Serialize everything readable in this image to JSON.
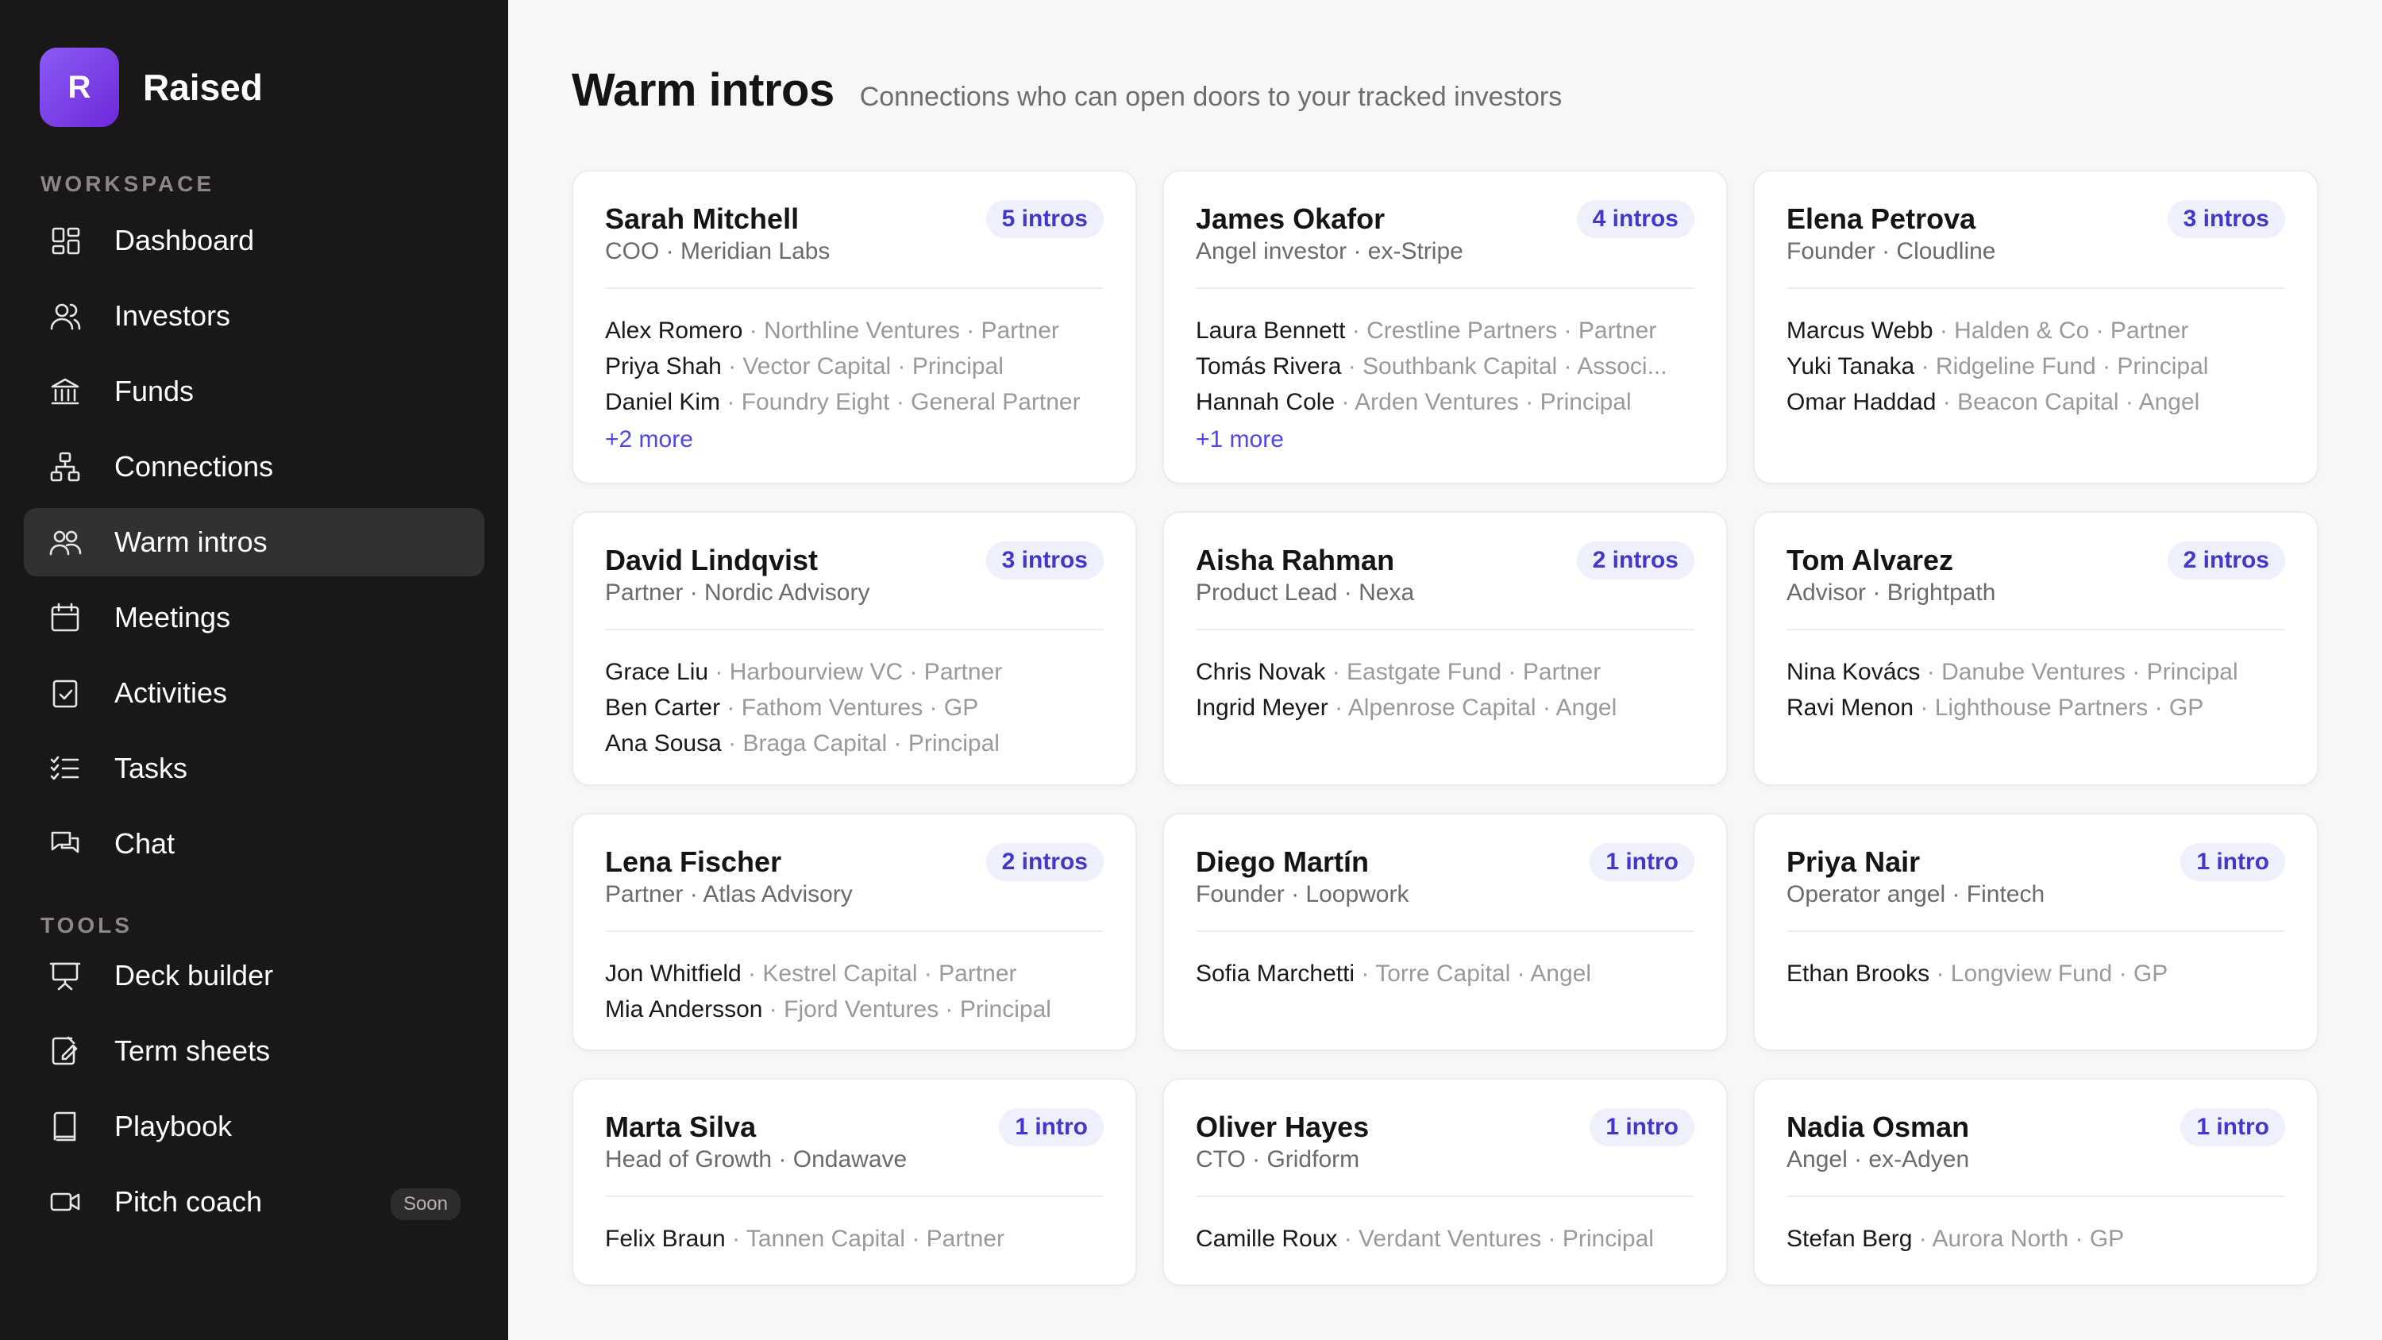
{
  "brand": {
    "logo_letter": "R",
    "name": "Raised"
  },
  "sidebar": {
    "workspace_label": "WORKSPACE",
    "tools_label": "TOOLS",
    "workspace_items": [
      {
        "label": "Dashboard",
        "icon": "grid-icon",
        "active": false
      },
      {
        "label": "Investors",
        "icon": "users-icon",
        "active": false
      },
      {
        "label": "Funds",
        "icon": "bank-icon",
        "active": false
      },
      {
        "label": "Connections",
        "icon": "network-icon",
        "active": false
      },
      {
        "label": "Warm intros",
        "icon": "user-group-icon",
        "active": true
      },
      {
        "label": "Meetings",
        "icon": "calendar-icon",
        "active": false
      },
      {
        "label": "Activities",
        "icon": "clipboard-check-icon",
        "active": false
      },
      {
        "label": "Tasks",
        "icon": "checklist-icon",
        "active": false
      },
      {
        "label": "Chat",
        "icon": "chat-icon",
        "active": false
      }
    ],
    "tool_items": [
      {
        "label": "Deck builder",
        "icon": "presentation-icon",
        "badge": ""
      },
      {
        "label": "Term sheets",
        "icon": "document-edit-icon",
        "badge": ""
      },
      {
        "label": "Playbook",
        "icon": "book-icon",
        "badge": ""
      },
      {
        "label": "Pitch coach",
        "icon": "video-icon",
        "badge": "Soon"
      }
    ]
  },
  "header": {
    "title": "Warm intros",
    "subtitle": "Connections who can open doors to your tracked investors"
  },
  "cards": [
    {
      "name": "Sarah Mitchell",
      "role": "COO · Meridian Labs",
      "badge": "5 intros",
      "connections": [
        {
          "name": "Alex Romero",
          "meta": " · Northline Ventures · Partner"
        },
        {
          "name": "Priya Shah",
          "meta": " · Vector Capital · Principal"
        },
        {
          "name": "Daniel Kim",
          "meta": " · Foundry Eight · General Partner"
        }
      ],
      "more": "+2 more"
    },
    {
      "name": "James Okafor",
      "role": "Angel investor · ex-Stripe",
      "badge": "4 intros",
      "connections": [
        {
          "name": "Laura Bennett",
          "meta": " · Crestline Partners · Partner"
        },
        {
          "name": "Tomás Rivera",
          "meta": " · Southbank Capital · Associ..."
        },
        {
          "name": "Hannah Cole",
          "meta": " · Arden Ventures · Principal"
        }
      ],
      "more": "+1 more"
    },
    {
      "name": "Elena Petrova",
      "role": "Founder · Cloudline",
      "badge": "3 intros",
      "connections": [
        {
          "name": "Marcus Webb",
          "meta": " · Halden & Co · Partner"
        },
        {
          "name": "Yuki Tanaka",
          "meta": " · Ridgeline Fund · Principal"
        },
        {
          "name": "Omar Haddad",
          "meta": " · Beacon Capital · Angel"
        }
      ],
      "more": ""
    },
    {
      "name": "David Lindqvist",
      "role": "Partner · Nordic Advisory",
      "badge": "3 intros",
      "connections": [
        {
          "name": "Grace Liu",
          "meta": " · Harbourview VC · Partner"
        },
        {
          "name": "Ben Carter",
          "meta": " · Fathom Ventures · GP"
        },
        {
          "name": "Ana Sousa",
          "meta": " · Braga Capital · Principal"
        }
      ],
      "more": ""
    },
    {
      "name": "Aisha Rahman",
      "role": "Product Lead · Nexa",
      "badge": "2 intros",
      "connections": [
        {
          "name": "Chris Novak",
          "meta": " · Eastgate Fund · Partner"
        },
        {
          "name": "Ingrid Meyer",
          "meta": " · Alpenrose Capital · Angel"
        }
      ],
      "more": ""
    },
    {
      "name": "Tom Alvarez",
      "role": "Advisor · Brightpath",
      "badge": "2 intros",
      "connections": [
        {
          "name": "Nina Kovács",
          "meta": " · Danube Ventures · Principal"
        },
        {
          "name": "Ravi Menon",
          "meta": " · Lighthouse Partners · GP"
        }
      ],
      "more": ""
    },
    {
      "name": "Lena Fischer",
      "role": "Partner · Atlas Advisory",
      "badge": "2 intros",
      "connections": [
        {
          "name": "Jon Whitfield",
          "meta": " · Kestrel Capital · Partner"
        },
        {
          "name": "Mia Andersson",
          "meta": " · Fjord Ventures · Principal"
        }
      ],
      "more": ""
    },
    {
      "name": "Diego Martín",
      "role": "Founder · Loopwork",
      "badge": "1 intro",
      "connections": [
        {
          "name": "Sofia Marchetti",
          "meta": " · Torre Capital · Angel"
        }
      ],
      "more": ""
    },
    {
      "name": "Priya Nair",
      "role": "Operator angel · Fintech",
      "badge": "1 intro",
      "connections": [
        {
          "name": "Ethan Brooks",
          "meta": " · Longview Fund · GP"
        }
      ],
      "more": ""
    },
    {
      "name": "Marta Silva",
      "role": "Head of Growth · Ondawave",
      "badge": "1 intro",
      "connections": [
        {
          "name": "Felix Braun",
          "meta": " · Tannen Capital · Partner"
        }
      ],
      "more": ""
    },
    {
      "name": "Oliver Hayes",
      "role": "CTO · Gridform",
      "badge": "1 intro",
      "connections": [
        {
          "name": "Camille Roux",
          "meta": " · Verdant Ventures · Principal"
        }
      ],
      "more": ""
    },
    {
      "name": "Nadia Osman",
      "role": "Angel · ex-Adyen",
      "badge": "1 intro",
      "connections": [
        {
          "name": "Stefan Berg",
          "meta": " · Aurora North · GP"
        }
      ],
      "more": ""
    }
  ]
}
